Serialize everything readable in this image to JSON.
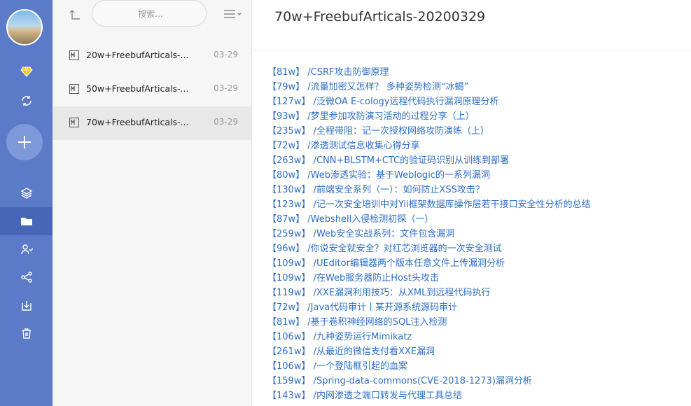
{
  "sidebar": {
    "icons": [
      "diamond-icon",
      "sync-icon",
      "plus-icon",
      "layers-icon",
      "folder-icon",
      "users-icon",
      "share-icon",
      "download-icon",
      "trash-icon"
    ]
  },
  "notes_panel": {
    "search_placeholder": "搜索...",
    "notes": [
      {
        "title": "20w+FreebufArticals-...",
        "date": "03-29"
      },
      {
        "title": "50w+FreebufArticals-...",
        "date": "03-29"
      },
      {
        "title": "70w+FreebufArticals-...",
        "date": "03-29"
      }
    ]
  },
  "editor": {
    "title": "70w+FreebufArticals-20200329",
    "articles": [
      "【81w】 /CSRF攻击防御原理",
      "【79w】 /流量加密又怎样？ 多种姿势检测“冰蝎”",
      "【127w】 /泛微OA E-cology远程代码执行漏洞原理分析",
      "【93w】 /梦里参加攻防演习活动的过程分享（上）",
      "【235w】 /全程带阻：记一次授权网络攻防演练（上）",
      "【72w】 /渗透测试信息收集心得分享",
      "【263w】 /CNN+BLSTM+CTC的验证码识别从训练到部署",
      "【80w】 /Web渗透实验：基于Weblogic的一系列漏洞",
      "【130w】 /前端安全系列（一）：如何防止XSS攻击？",
      "【123w】 /记一次安全培训中对Yii框架数据库操作层若干接口安全性分析的总结",
      "【87w】 /Webshell入侵检测初探（一）",
      "【259w】 /Web安全实战系列：文件包含漏洞",
      "【96w】 /你说安全就安全？对红芯浏览器的一次安全测试",
      "【109w】 /UEditor编辑器两个版本任意文件上传漏洞分析",
      "【109w】 /在Web服务器防止Host头攻击",
      "【119w】 /XXE漏洞利用技巧：从XML到远程代码执行",
      "【72w】 /Java代码审计丨某开源系统源码审计",
      "【81w】 /基于卷积神经网络的SQL注入检测",
      "【106w】 /九种姿势运行Mimikatz",
      "【261w】 /从最近的微信支付看XXE漏洞",
      "【106w】 /一个登陆框引起的血案",
      "【159w】 /Spring-data-commons(CVE-2018-1273)漏洞分析",
      "【143w】 /内网渗透之端口转发与代理工具总结"
    ]
  },
  "colors": {
    "rail": "#5b7bc8",
    "rail_active": "#4766b6",
    "link": "#2e6ec4",
    "diamond": "#f5c518"
  }
}
